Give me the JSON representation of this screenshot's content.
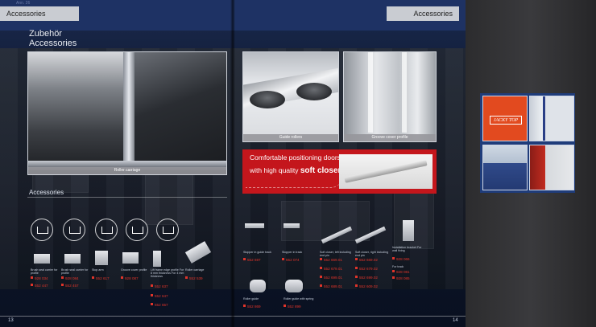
{
  "header": {
    "left_tab": "Accessories",
    "right_tab": "Accessories",
    "tiny_label": "Ann. 26"
  },
  "title": {
    "line1": "Zubehör",
    "line2": "Accessories"
  },
  "photos": {
    "main_caption": "Roller carriage",
    "guide_caption": "Guide rollers",
    "groove_caption": "Groove cover profile"
  },
  "banner": {
    "line1": "Comfortable positioning doors",
    "line2_prefix": "with  high quality ",
    "line2_bold": "soft closer",
    "line2_suffix": "."
  },
  "section_label": "Accessories",
  "left_products": [
    {
      "label": "Brush seal carrier for profile",
      "codes": [
        "928 034",
        "552 447"
      ]
    },
    {
      "label": "Brush seal carrier for profile",
      "codes": [
        "928 084",
        "552 457"
      ]
    },
    {
      "label": "Stop arm",
      "codes": [
        "552 617"
      ]
    },
    {
      "label": "Groove cover profile",
      "codes": [
        "928 087"
      ]
    },
    {
      "label": "Lift frame edge profile For 8 mm thickness For 4 mm thickness",
      "codes": [
        "552 637",
        "552 647",
        "552 657"
      ]
    },
    {
      "label": "Roller carriage",
      "codes": [
        "552 539"
      ]
    }
  ],
  "right_products": [
    {
      "label": "Stopper in guide track",
      "codes": [
        "552 697"
      ]
    },
    {
      "label": "Stopper in track",
      "codes": [
        "552 074"
      ]
    },
    {
      "label": "Soft closer, left including end pin",
      "codes": [
        "552 669.01",
        "552 679.01",
        "552 699.01",
        "552 689.01"
      ]
    },
    {
      "label": "Soft closer, right including end pin",
      "codes": [
        "552 669.02",
        "552 679.02",
        "552 699.02",
        "552 609.02"
      ]
    },
    {
      "label": "Installation bracket For wall fixing",
      "codes": [
        "928 066"
      ]
    },
    {
      "label": "For track",
      "codes": [
        "928 081",
        "928 085"
      ]
    },
    {
      "label": "Roller guide",
      "codes": [
        "552 869"
      ]
    },
    {
      "label": "Roller guide with spring",
      "codes": [
        "552 899"
      ]
    }
  ],
  "page_numbers": {
    "left": "13",
    "right": "14"
  },
  "thumbnails": {
    "logo_text": "JACKY TOP"
  }
}
